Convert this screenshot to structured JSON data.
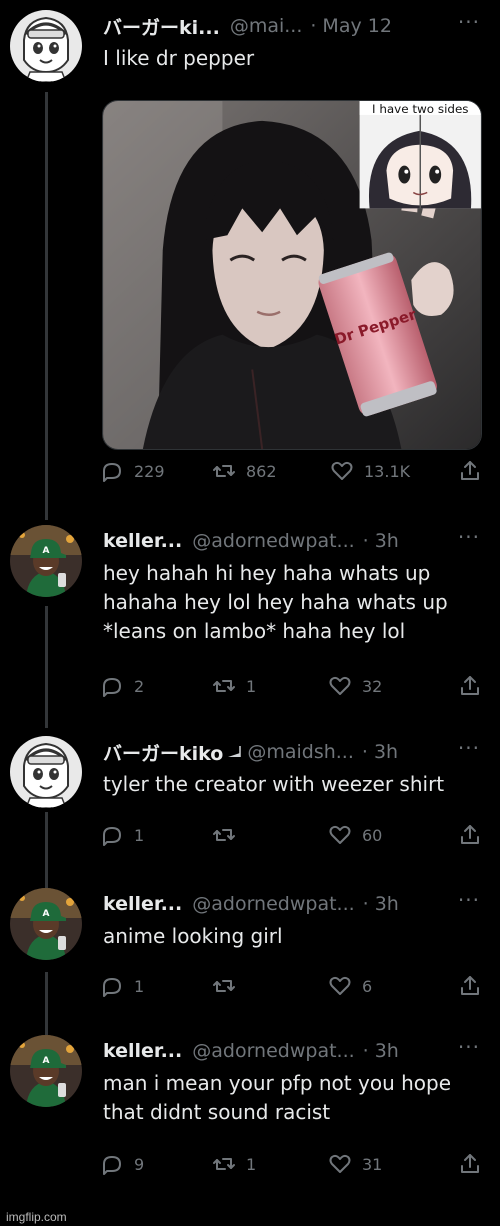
{
  "tweets": [
    {
      "name": "バーガーki...",
      "handle": "@mai...",
      "time": "May 12",
      "text": [
        "I like dr pepper"
      ],
      "media_caption": "I have two sides",
      "can_label": "Dr Pepper",
      "replies": "229",
      "retweets": "862",
      "likes": "13.1K"
    },
    {
      "name": "keller...",
      "handle": "@adornedwpat...",
      "time": "3h",
      "text": [
        "hey hahah hi hey haha whats up",
        "hahaha hey lol hey haha whats up",
        "*leans on lambo* haha hey lol"
      ],
      "replies": "2",
      "retweets": "1",
      "likes": "32"
    },
    {
      "name": "バーガーkiko",
      "handle": "@maidsh...",
      "time": "3h",
      "text": [
        "tyler the creator with weezer shirt"
      ],
      "replies": "1",
      "retweets": "",
      "likes": "60"
    },
    {
      "name": "keller...",
      "handle": "@adornedwpat...",
      "time": "3h",
      "text": [
        "anime looking girl"
      ],
      "replies": "1",
      "retweets": "",
      "likes": "6"
    },
    {
      "name": "keller...",
      "handle": "@adornedwpat...",
      "time": "3h",
      "text": [
        "man i mean your pfp not you hope",
        "that didnt sound racist"
      ],
      "replies": "9",
      "retweets": "1",
      "likes": "31"
    }
  ],
  "icons": {
    "reply": "reply-icon",
    "retweet": "retweet-icon",
    "like": "heart-icon",
    "share": "share-icon",
    "more": "more-icon"
  },
  "colors": {
    "background": "#000000",
    "text": "#e7e9ea",
    "muted": "#71767b",
    "thread_line": "#333639"
  },
  "meta": {
    "more_glyph": "···",
    "separator": "·",
    "watermark": "imgflip.com"
  }
}
